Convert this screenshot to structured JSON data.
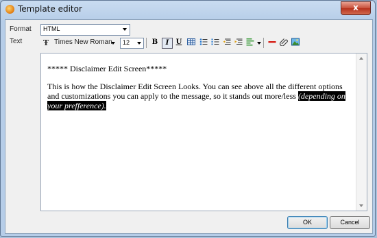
{
  "window": {
    "title": "Template editor",
    "close_label": "x"
  },
  "form": {
    "format_label": "Format",
    "format_value": "HTML",
    "text_label": "Text"
  },
  "toolbar": {
    "font_icon": "Ŧ",
    "font_name": "Times New Roman",
    "font_size": "12",
    "bold": "B",
    "italic": "I",
    "underline": "U"
  },
  "editor": {
    "heading": "***** Disclaimer Edit Screen*****",
    "body": "This is how the Disclaimer Edit Screen Looks. You can see above all the different options and customizations you can apply to the message, so it stands out more/less ",
    "highlight": "(depending on your prefference)."
  },
  "buttons": {
    "ok": "OK",
    "cancel": "Cancel"
  }
}
